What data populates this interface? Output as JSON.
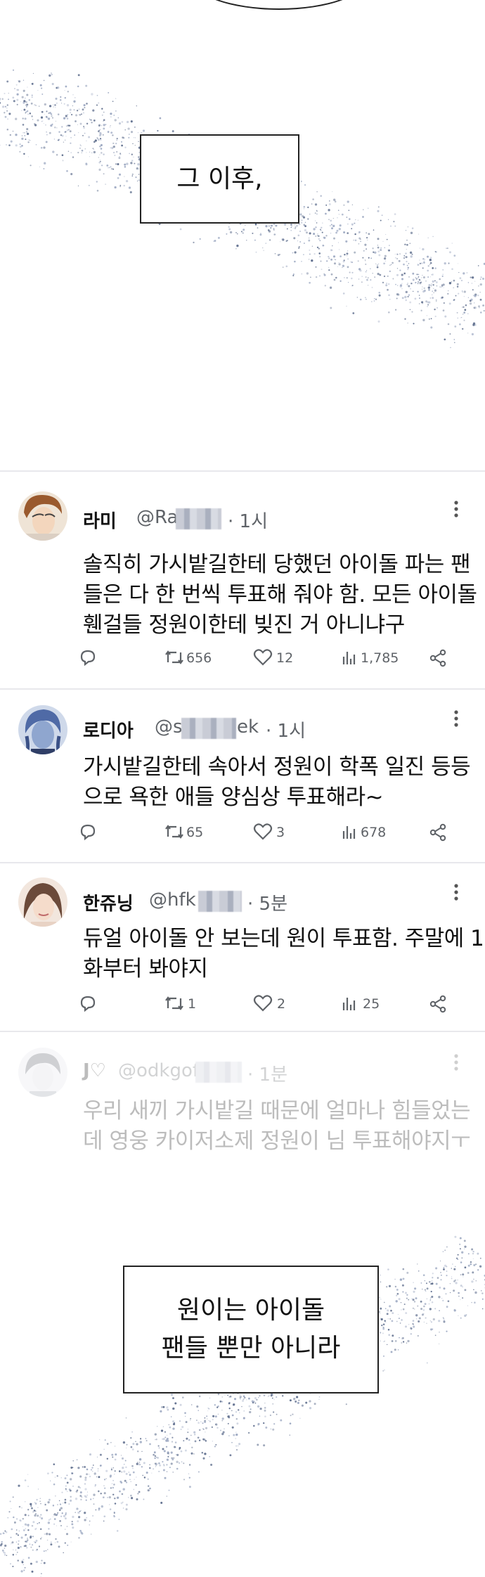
{
  "captions": {
    "first": "그 이후,",
    "second_line1": "원이는 아이돌",
    "second_line2": "팬들 뿐만 아니라"
  },
  "tweets": [
    {
      "name": "라미",
      "handle_prefix": "@Ra",
      "handle_suffix": "",
      "time": "· 1시",
      "lines": [
        "솔직히 가시밭길한테 당했던 아이돌 파는 팬",
        "들은 다 한 번씩 투표해 줘야 함. 모든 아이돌",
        "휀걸들 정원이한테 빚진 거 아니냐구"
      ],
      "retweets": "656",
      "likes": "12",
      "views": "1,785"
    },
    {
      "name": "로디아",
      "handle_prefix": "@sf",
      "handle_suffix": "ek",
      "time": "· 1시",
      "lines": [
        "가시밭길한테 속아서 정원이 학폭 일진 등등",
        "으로 욕한 애들 양심상 투표해라~"
      ],
      "retweets": "65",
      "likes": "3",
      "views": "678"
    },
    {
      "name": "한쥬닝",
      "handle_prefix": "@hfk",
      "handle_suffix": "",
      "time": "· 5분",
      "lines": [
        "듀얼 아이돌 안 보는데 원이 투표함. 주말에 1",
        "화부터 봐야지"
      ],
      "retweets": "1",
      "likes": "2",
      "views": "25"
    },
    {
      "name": "J♡",
      "handle_prefix": "@odkgof",
      "handle_suffix": "",
      "time": "· 1분",
      "lines": [
        "우리 새끼 가시밭길 때문에 얼마나 힘들었는",
        "데 영웅 카이저소제 정원이 님 투표해야지ㅜ"
      ]
    }
  ],
  "icons": [
    "reply-icon",
    "retweet-icon",
    "like-icon",
    "views-icon",
    "share-icon",
    "more-icon"
  ],
  "colors": {
    "text": "#111111",
    "muted": "#5f6368",
    "separator": "#e8e8ec",
    "sparkle": "#5a6a8a"
  }
}
